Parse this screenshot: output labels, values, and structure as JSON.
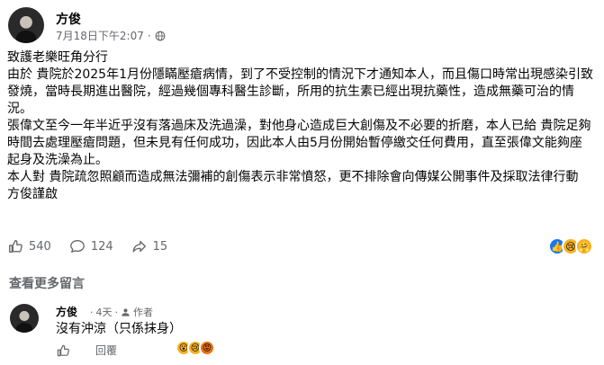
{
  "post": {
    "author": "方俊",
    "timestamp": "7月18日下午2:07",
    "separator": "·",
    "body_lines": [
      "致護老樂旺角分行",
      "由於 貴院於2025年1月份隱瞞壓瘡病情，到了不受控制的情況下才通知本人，而且傷口時常出現感染引致發燒，當時長期進出醫院，經過幾個專科醫生診斷，所用的抗生素已經出現抗藥性，造成無藥可治的情況。",
      "張偉文至今一年半近乎沒有落過床及洗過澡，對他身心造成巨大創傷及不必要的折磨，本人已給 貴院足夠時間去處理壓瘡問題，但未見有任何成功，因此本人由5月份開始暫停繳交任何費用，直至張偉文能夠座起身及洗澡為止。",
      "本人對 貴院疏忽照顧而造成無法彌補的創傷表示非常憤怒，更不排除會向傳媒公開事件及採取法律行動",
      "方俊謹啟"
    ],
    "stats": {
      "likes": "540",
      "comments": "124",
      "shares": "15"
    }
  },
  "more_comments_label": "查看更多留言",
  "comment": {
    "author": "方俊",
    "time": "4天",
    "author_badge": "作者",
    "text": "沒有沖涼（只係抹身）",
    "reply_label": "回覆"
  },
  "colors": {
    "meta_gray": "#65676b",
    "like_blue": "#1877f2",
    "emoji_yellow": "#f7b125"
  },
  "icons": [
    "globe-icon",
    "like-icon",
    "comment-icon",
    "share-icon",
    "author-badge-icon"
  ]
}
